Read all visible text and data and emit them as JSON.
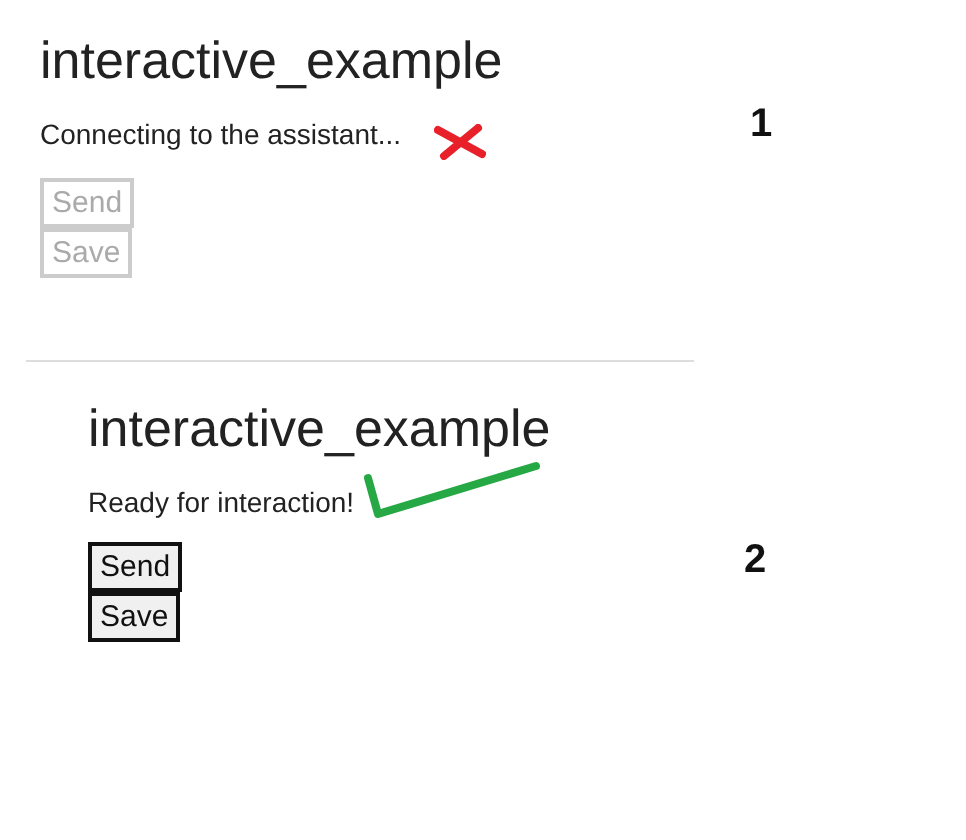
{
  "panels": [
    {
      "number": "1",
      "title": "interactive_example",
      "status": "Connecting to the assistant...",
      "annotation": {
        "kind": "cross"
      },
      "buttons": [
        {
          "label": "Send",
          "disabled": true
        },
        {
          "label": "Save",
          "disabled": true
        }
      ]
    },
    {
      "number": "2",
      "title": "interactive_example",
      "status": "Ready for interaction!",
      "annotation": {
        "kind": "check"
      },
      "buttons": [
        {
          "label": "Send",
          "disabled": false
        },
        {
          "label": "Save",
          "disabled": false
        }
      ]
    }
  ]
}
